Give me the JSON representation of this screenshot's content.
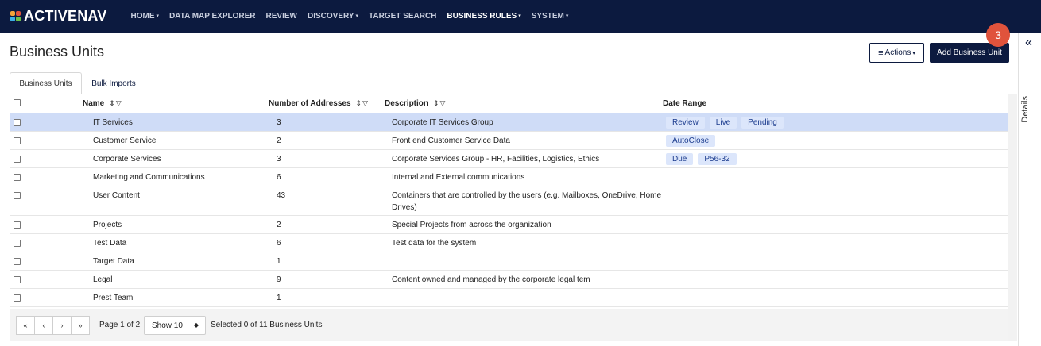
{
  "brand": {
    "name": "ACTIVENAV",
    "colors": [
      "#f2a33a",
      "#e0533c",
      "#3bb0e6",
      "#6cc04a"
    ]
  },
  "nav": [
    {
      "label": "HOME",
      "dropdown": true,
      "active": false
    },
    {
      "label": "DATA MAP EXPLORER",
      "dropdown": false,
      "active": false
    },
    {
      "label": "REVIEW",
      "dropdown": false,
      "active": false
    },
    {
      "label": "DISCOVERY",
      "dropdown": true,
      "active": false
    },
    {
      "label": "TARGET SEARCH",
      "dropdown": false,
      "active": false
    },
    {
      "label": "BUSINESS RULES",
      "dropdown": true,
      "active": true
    },
    {
      "label": "SYSTEM",
      "dropdown": true,
      "active": false
    }
  ],
  "page": {
    "title": "Business Units"
  },
  "toolbar": {
    "actions_label": "Actions",
    "add_label": "Add Business Unit",
    "notification_count": "3"
  },
  "tabs": [
    {
      "label": "Business Units",
      "active": true
    },
    {
      "label": "Bulk Imports",
      "active": false
    }
  ],
  "table": {
    "columns": {
      "name": "Name",
      "addresses": "Number of Addresses",
      "description": "Description",
      "date_range": "Date Range"
    },
    "rows": [
      {
        "name": "IT Services",
        "addresses": "3",
        "description": "Corporate IT Services Group",
        "tags": [
          "Review",
          "Live",
          "Pending"
        ],
        "selected": true
      },
      {
        "name": "Customer Service",
        "addresses": "2",
        "description": "Front end Customer Service Data",
        "tags": [
          "AutoClose"
        ],
        "selected": false
      },
      {
        "name": "Corporate Services",
        "addresses": "3",
        "description": "Corporate Services Group - HR, Facilities, Logistics, Ethics",
        "tags": [
          "Due",
          "P56-32"
        ],
        "selected": false
      },
      {
        "name": "Marketing and Communications",
        "addresses": "6",
        "description": "Internal and External communications",
        "tags": [],
        "selected": false
      },
      {
        "name": "User Content",
        "addresses": "43",
        "description": "Containers that are controlled by the users (e.g. Mailboxes, OneDrive, Home Drives)",
        "tags": [],
        "selected": false
      },
      {
        "name": "Projects",
        "addresses": "2",
        "description": "Special Projects from across the organization",
        "tags": [],
        "selected": false
      },
      {
        "name": "Test Data",
        "addresses": "6",
        "description": "Test data for the system",
        "tags": [],
        "selected": false
      },
      {
        "name": "Target Data",
        "addresses": "1",
        "description": "",
        "tags": [],
        "selected": false
      },
      {
        "name": "Legal",
        "addresses": "9",
        "description": "Content owned and managed by the corporate legal tem",
        "tags": [],
        "selected": false
      },
      {
        "name": "Prest Team",
        "addresses": "1",
        "description": "",
        "tags": [],
        "selected": false
      }
    ]
  },
  "pagination": {
    "first": "«",
    "prev": "‹",
    "next": "›",
    "last": "»",
    "page_info": "Page 1 of 2",
    "show": "Show 10",
    "selected_info": "Selected 0 of 11 Business Units"
  },
  "details": {
    "label": "Details",
    "collapse_icon": "double-chevron-left-icon"
  }
}
